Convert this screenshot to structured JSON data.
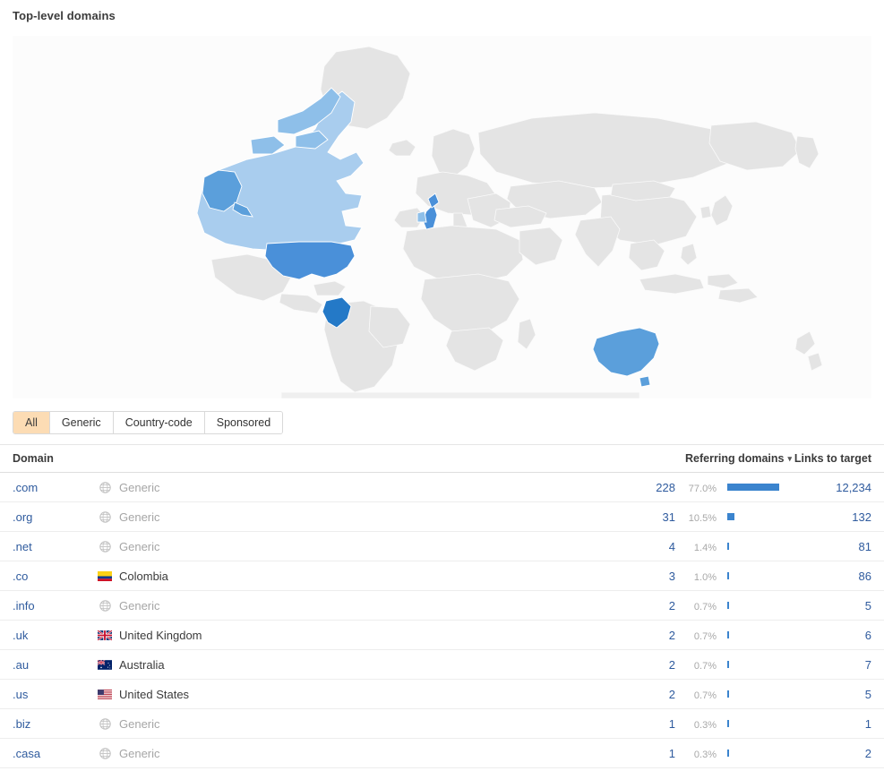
{
  "panel": {
    "title": "Top-level domains"
  },
  "tabs": [
    {
      "label": "All",
      "active": true
    },
    {
      "label": "Generic",
      "active": false
    },
    {
      "label": "Country-code",
      "active": false
    },
    {
      "label": "Sponsored",
      "active": false
    }
  ],
  "table": {
    "headers": {
      "domain": "Domain",
      "referring_domains": "Referring domains",
      "sort_caret": "▾",
      "links_to_target": "Links to target"
    },
    "rows": [
      {
        "domain": ".com",
        "type": "Generic",
        "icon": "globe-icon",
        "referring_domains": "228",
        "percent": "77.0%",
        "bar_pct": 77.0,
        "links_to_target": "12,234"
      },
      {
        "domain": ".org",
        "type": "Generic",
        "icon": "globe-icon",
        "referring_domains": "31",
        "percent": "10.5%",
        "bar_pct": 10.5,
        "links_to_target": "132"
      },
      {
        "domain": ".net",
        "type": "Generic",
        "icon": "globe-icon",
        "referring_domains": "4",
        "percent": "1.4%",
        "bar_pct": 1.4,
        "links_to_target": "81"
      },
      {
        "domain": ".co",
        "type": "Colombia",
        "icon": "flag-colombia-icon",
        "referring_domains": "3",
        "percent": "1.0%",
        "bar_pct": 1.0,
        "links_to_target": "86"
      },
      {
        "domain": ".info",
        "type": "Generic",
        "icon": "globe-icon",
        "referring_domains": "2",
        "percent": "0.7%",
        "bar_pct": 0.7,
        "links_to_target": "5"
      },
      {
        "domain": ".uk",
        "type": "United Kingdom",
        "icon": "flag-uk-icon",
        "referring_domains": "2",
        "percent": "0.7%",
        "bar_pct": 0.7,
        "links_to_target": "6"
      },
      {
        "domain": ".au",
        "type": "Australia",
        "icon": "flag-australia-icon",
        "referring_domains": "2",
        "percent": "0.7%",
        "bar_pct": 0.7,
        "links_to_target": "7"
      },
      {
        "domain": ".us",
        "type": "United States",
        "icon": "flag-usa-icon",
        "referring_domains": "2",
        "percent": "0.7%",
        "bar_pct": 0.7,
        "links_to_target": "5"
      },
      {
        "domain": ".biz",
        "type": "Generic",
        "icon": "globe-icon",
        "referring_domains": "1",
        "percent": "0.3%",
        "bar_pct": 0.3,
        "links_to_target": "1"
      },
      {
        "domain": ".casa",
        "type": "Generic",
        "icon": "globe-icon",
        "referring_domains": "1",
        "percent": "0.3%",
        "bar_pct": 0.3,
        "links_to_target": "2"
      }
    ]
  },
  "map": {
    "highlighted": [
      {
        "country": "United States",
        "shade": "#4a90d9"
      },
      {
        "country": "Canada",
        "shade": "#a9cdee"
      },
      {
        "country": "Colombia",
        "shade": "#2479c7"
      },
      {
        "country": "United Kingdom",
        "shade": "#4a90d9"
      },
      {
        "country": "Australia",
        "shade": "#5b9fdb"
      }
    ],
    "base_color": "#e4e4e4"
  },
  "colors": {
    "accent_bar": "#3b84ce",
    "link": "#2f5b9e",
    "active_tab_bg": "#fcdcb4",
    "muted_text": "#a6a6a6"
  }
}
